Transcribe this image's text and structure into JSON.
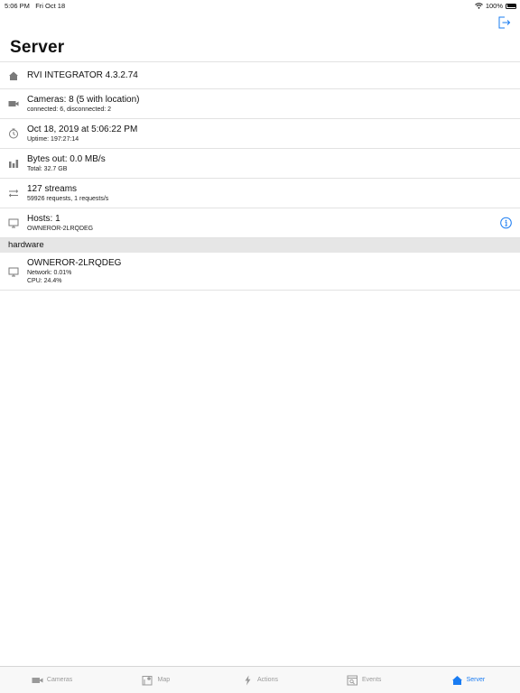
{
  "status_bar": {
    "time": "5:06 PM",
    "date": "Fri Oct 18",
    "battery": "100%"
  },
  "header": {
    "title": "Server"
  },
  "server": {
    "version": "RVI INTEGRATOR 4.3.2.74",
    "cameras": "Cameras: 8 (5 with location)",
    "cameras_sub": "connected: 6, disconnected: 2",
    "datetime": "Oct 18, 2019 at 5:06:22 PM",
    "uptime": "Uptime: 197:27:14",
    "bytes": "Bytes out: 0.0 MB/s",
    "bytes_total": "Total: 32.7 GB",
    "streams": "127 streams",
    "streams_sub": "59926 requests, 1 requests/s",
    "hosts": "Hosts: 1",
    "hosts_sub": "OWNEROR-2LRQDEG"
  },
  "hardware": {
    "section_title": "hardware",
    "host": "OWNEROR-2LRQDEG",
    "network": "Network: 0.01%",
    "cpu": "CPU: 24.4%"
  },
  "tabs": [
    {
      "label": "Cameras",
      "icon": "camera-icon"
    },
    {
      "label": "Map",
      "icon": "map-icon"
    },
    {
      "label": "Actions",
      "icon": "lightning-icon"
    },
    {
      "label": "Events",
      "icon": "events-icon"
    },
    {
      "label": "Server",
      "icon": "home-icon"
    }
  ],
  "colors": {
    "accent": "#1a7cf2",
    "icon_gray": "#7a7a7a",
    "inactive_tab": "#9a9a9a",
    "section_bg": "#e6e6e6"
  }
}
